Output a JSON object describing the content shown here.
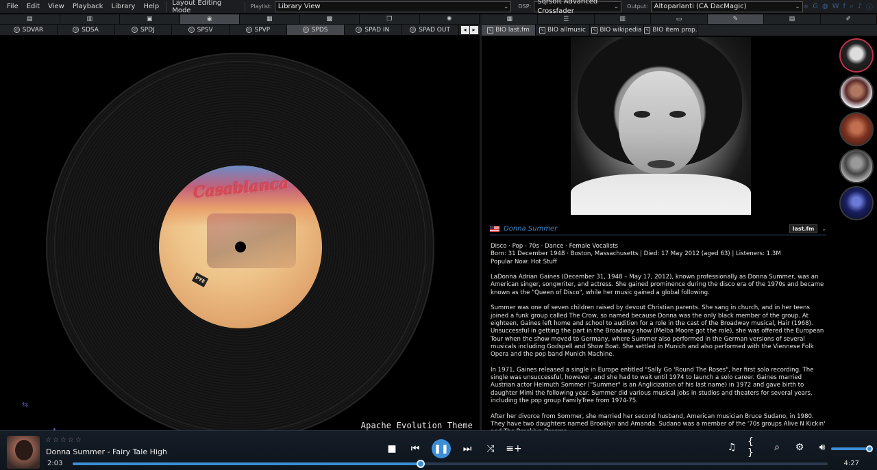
{
  "menu": [
    "File",
    "Edit",
    "View",
    "Playback",
    "Library",
    "Help"
  ],
  "layout_mode": "Layout Editing Mode",
  "playlist": {
    "label": "Playlist:",
    "value": "Library View"
  },
  "dsp": {
    "label": "DSP:",
    "value": "Sqrsoft Advanced Crossfader"
  },
  "output": {
    "label": "Output:",
    "value": "Altoparlanti (CA DacMagic)"
  },
  "left_tabs": [
    "SDVAR",
    "SDSA",
    "SPDJ",
    "SPSV",
    "SPVP",
    "SPDS",
    "SPAD IN",
    "SPAD OUT"
  ],
  "left_tabs_active": 5,
  "bio_tabs": [
    "BIO last.fm",
    "BIO allmusic",
    "BIO wikipedia",
    "BIO item prop."
  ],
  "bio_tabs_active": 0,
  "disc_label": {
    "brand": "Casablanca",
    "badge": "PYE"
  },
  "theme_label": "Apache Evolution Theme",
  "artist": {
    "name": "Donna Summer",
    "source": "last.fm",
    "tags": "Disco · Pop · 70s · Dance · Female Vocalists",
    "born_line": "Born: 31 December 1948 · Boston, Massachusetts  |  Died: 17 May 2012 (aged 63)  |  Listeners: 1.3M",
    "popular": "Popular Now: Hot Stuff",
    "bio": [
      "LaDonna Adrian Gaines (December 31, 1948 – May 17, 2012), known professionally as Donna Summer, was an American singer, songwriter, and actress. She gained prominence during the disco era of the 1970s and became known as the \"Queen of Disco\", while her music gained a global following.",
      "Summer was one of seven children raised by devout Christian parents. She sang in church, and in her teens joined a funk group called The Crow, so named because Donna was the only black member of the group. At eighteen, Gaines left home and school to audition for a role in the cast of the Broadway musical, Hair (1968). Unsuccessful in getting the part in the Broadway show (Melba Moore got the role), she was offered the European Tour when the show moved to Germany, where Summer also performed in the German versions of several musicals including Godspell and Show Boat. She settled in Munich and also performed with the Viennese Folk Opera and the pop band Munich Machine.",
      "In 1971, Gaines released a single in Europe entitled \"Sally Go 'Round The Roses\", her first solo recording. The single was unsuccessful, however, and she had to wait until 1974 to launch a solo career. Gaines married Austrian actor Helmuth Sommer (\"Summer\" is an Anglicization of his last name) in 1972 and gave birth to daughter Mimi the following year. Summer did various musical jobs in studios and theaters for several years, including the pop group FamilyTree from 1974-75.",
      "After her divorce from Sommer, she married her second husband, American musician Bruce Sudano, in 1980. They have two daughters named Brooklyn and Amanda. Sudano was a member of the '70s groups Alive N Kickin' and The Brooklyn Dreams."
    ]
  },
  "player": {
    "track": "Donna Summer - Fairy Tale High",
    "current_time": "2:03",
    "total_time": "4:27",
    "progress": 0.4607,
    "volume": 1.0,
    "rating": 0,
    "stars": "☆☆☆☆☆"
  },
  "colors": {
    "accent": "#3c8ed6",
    "artist_link": "#3d86c6",
    "active_thumb": "#c2324a"
  }
}
